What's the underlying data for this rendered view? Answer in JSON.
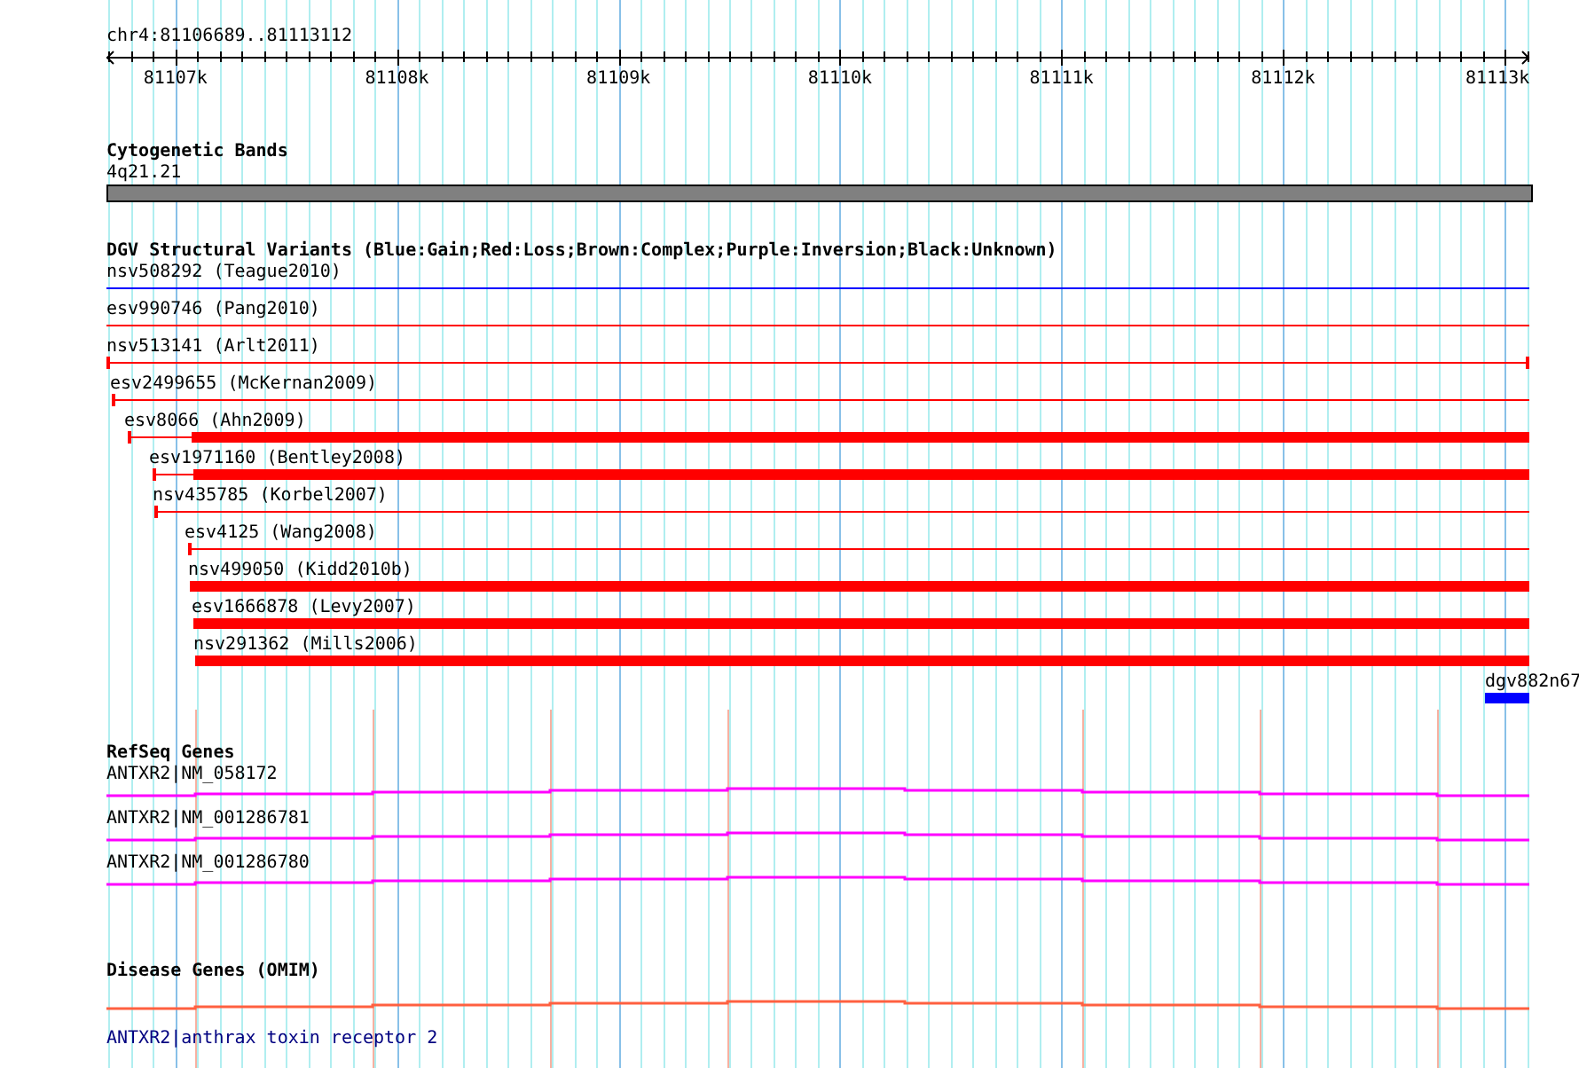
{
  "location": "chr4:81106689..81113112",
  "ruler": {
    "labels": [
      "81107k",
      "81108k",
      "81109k",
      "81110k",
      "81111k",
      "81112k",
      "81113k"
    ]
  },
  "tracks": [
    {
      "kind": "bands",
      "title": "Cytogenetic Bands",
      "items": [
        {
          "label": "4q21.21"
        }
      ]
    },
    {
      "kind": "variants",
      "title": "DGV Structural Variants (Blue:Gain;Red:Loss;Brown:Complex;Purple:Inversion;Black:Unknown)",
      "items": [
        {
          "label": "nsv508292 (Teague2010)",
          "kind": "line",
          "color": "#0000ff"
        },
        {
          "label": "esv990746 (Pang2010)",
          "kind": "line",
          "color": "#ff0000"
        },
        {
          "label": "nsv513141 (Arlt2011)",
          "kind": "line",
          "color": "#ff0000"
        },
        {
          "label": "esv2499655 (McKernan2009)",
          "kind": "line",
          "color": "#ff0000"
        },
        {
          "label": "esv8066 (Ahn2009)",
          "kind": "split",
          "color": "#ff0000"
        },
        {
          "label": "esv1971160 (Bentley2008)",
          "kind": "split",
          "color": "#ff0000"
        },
        {
          "label": "nsv435785 (Korbel2007)",
          "kind": "line",
          "color": "#ff0000"
        },
        {
          "label": "esv4125 (Wang2008)",
          "kind": "line",
          "color": "#ff0000"
        },
        {
          "label": "nsv499050 (Kidd2010b)",
          "kind": "bar",
          "color": "#ff0000"
        },
        {
          "label": "esv1666878 (Levy2007)",
          "kind": "bar",
          "color": "#ff0000"
        },
        {
          "label": "nsv291362 (Mills2006)",
          "kind": "bar",
          "color": "#ff0000"
        },
        {
          "label": "dgv882n67",
          "kind": "bar",
          "color": "#0000ff"
        }
      ]
    },
    {
      "kind": "genes",
      "title": "RefSeq Genes",
      "items": [
        {
          "label": "ANTXR2|NM_058172",
          "color": "#ff00ff"
        },
        {
          "label": "ANTXR2|NM_001286781",
          "color": "#ff00ff"
        },
        {
          "label": "ANTXR2|NM_001286780",
          "color": "#ff00ff"
        }
      ]
    },
    {
      "kind": "disease",
      "title": "Disease Genes (OMIM)",
      "items": [
        {
          "label": "ANTXR2|anthrax toxin receptor 2",
          "color": "#ff6040"
        }
      ]
    }
  ]
}
